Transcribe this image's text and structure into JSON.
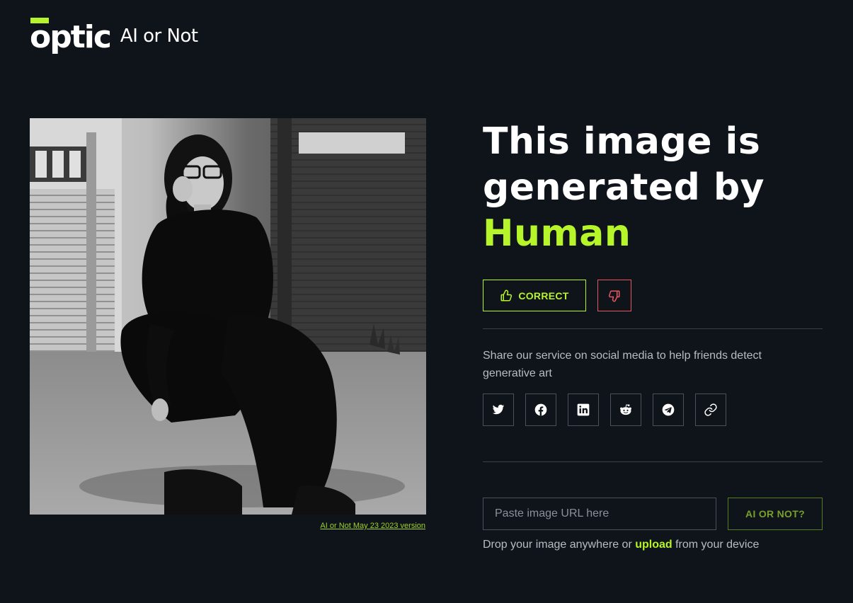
{
  "header": {
    "brand": "optic",
    "product": "AI or Not"
  },
  "image_panel": {
    "alt": "Black and white photo of a person crouching in front of a wooden building",
    "version_link": "AI or Not May 23 2023 version"
  },
  "result": {
    "line1": "This image is",
    "line2": "generated by",
    "verdict": "Human"
  },
  "feedback": {
    "correct_label": "CORRECT",
    "correct_icon": "thumbs-up-icon",
    "wrong_icon": "thumbs-down-icon"
  },
  "share": {
    "text": "Share our service on social media to help friends detect generative art",
    "networks": [
      "twitter-icon",
      "facebook-icon",
      "linkedin-icon",
      "reddit-icon",
      "telegram-icon",
      "link-icon"
    ]
  },
  "check": {
    "url_placeholder": "Paste image URL here",
    "submit_label": "AI OR NOT?",
    "drop_prefix": "Drop your image anywhere or",
    "upload_label": "upload",
    "drop_suffix": "from your device"
  },
  "colors": {
    "background": "#0f141b",
    "accent": "#b5f52a",
    "danger": "#e8555f",
    "muted_text": "#b7bcc3",
    "border": "#4a5058"
  }
}
